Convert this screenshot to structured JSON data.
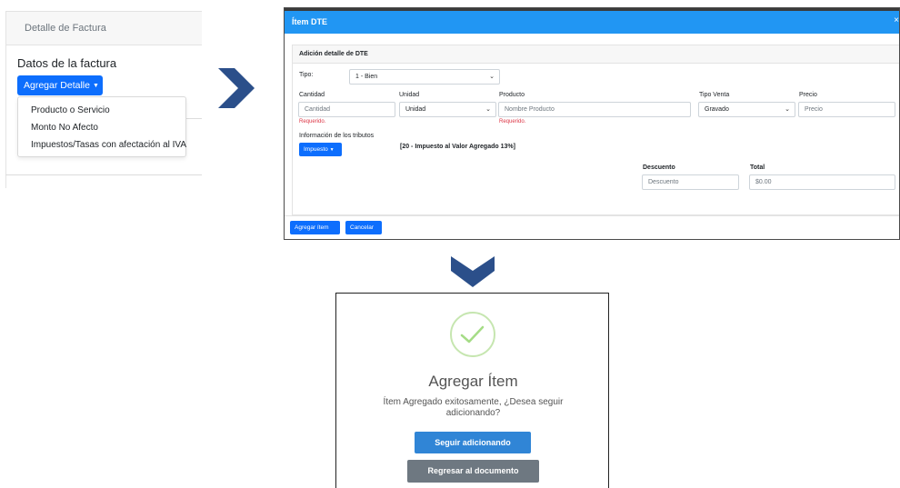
{
  "invoice_panel": {
    "header": "Detalle de Factura",
    "section_title": "Datos de la factura",
    "add_detail_button": "Agregar Detalle",
    "dropdown_items": [
      "Producto o Servicio",
      "Monto No Afecto",
      "Impuestos/Tasas con afectación al IVA"
    ]
  },
  "item_modal": {
    "title": "Ítem DTE",
    "close": "×",
    "section_header": "Adición detalle de DTE",
    "tipo_label": "Tipo:",
    "tipo_value": "1 - Bien",
    "cantidad_label": "Cantidad",
    "cantidad_placeholder": "Cantidad",
    "cantidad_error": "Requerido.",
    "unidad_label": "Unidad",
    "unidad_value": "Unidad",
    "producto_label": "Producto",
    "producto_placeholder": "Nombre Producto",
    "producto_error": "Requerido.",
    "tipo_venta_label": "Tipo Venta",
    "tipo_venta_value": "Gravado",
    "precio_label": "Precio",
    "precio_placeholder": "Precio",
    "tributos_label": "Información de los tributos",
    "impuesto_button": "Impuesto",
    "tributo_text": "[20 - Impuesto al Valor Agregado 13%]",
    "descuento_label": "Descuento",
    "descuento_placeholder": "Descuento",
    "total_label": "Total",
    "total_value": "$0.00",
    "add_item_button": "Agregar ítem",
    "cancel_button": "Cancelar"
  },
  "success_dialog": {
    "title": "Agregar Ítem",
    "message": "Ítem Agregado exitosamente, ¿Desea seguir adicionando?",
    "continue_button": "Seguir adicionando",
    "back_button": "Regresar al documento"
  },
  "colors": {
    "primary": "#0d6efd",
    "modal_header": "#2196f3",
    "arrow": "#2b4f8a",
    "success_check": "#a5dc86",
    "confirm": "#3085d6",
    "secondary": "#6e7881",
    "error": "#dc3545"
  },
  "icons": [
    "chevron-right-icon",
    "chevron-down-icon",
    "check-icon",
    "caret-down-icon",
    "close-icon"
  ]
}
